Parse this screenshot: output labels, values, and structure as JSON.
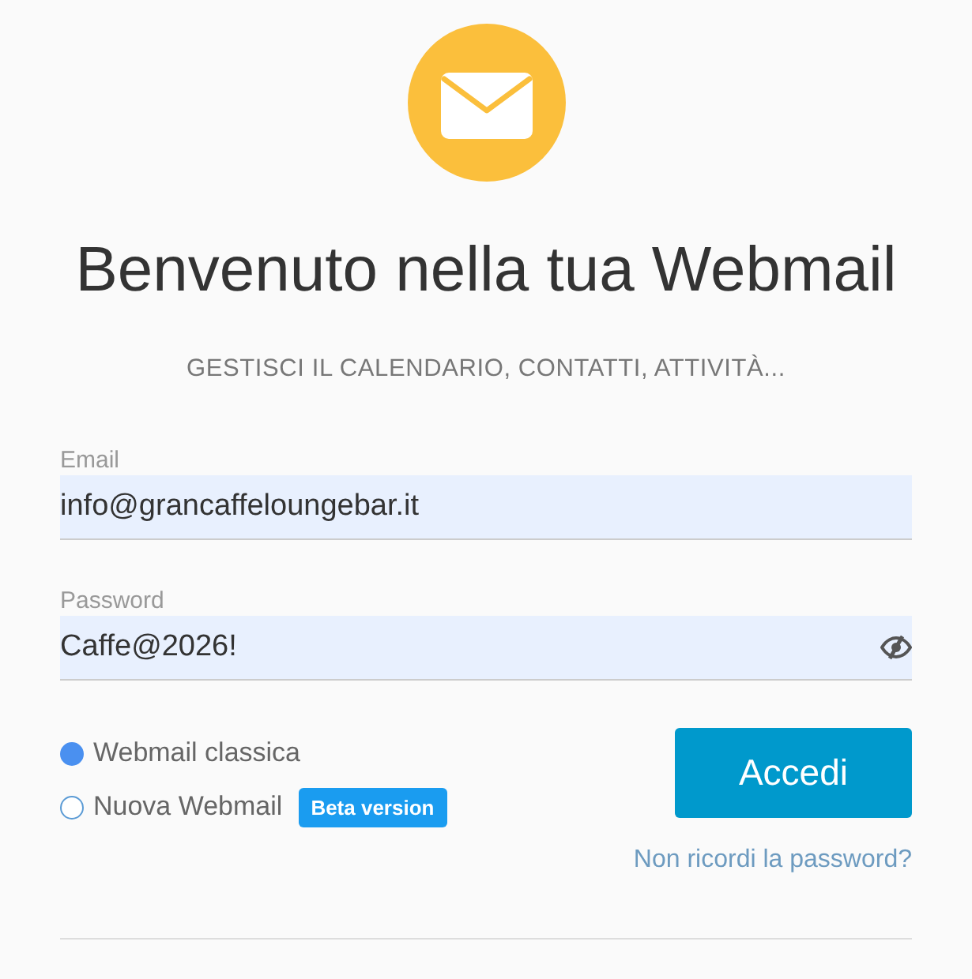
{
  "title": "Benvenuto nella tua Webmail",
  "subtitle": "GESTISCI IL CALENDARIO, CONTATTI, ATTIVITÀ...",
  "fields": [
    {
      "label": "Email",
      "value": "info@grancaffeloungebar.it",
      "kind": "text"
    },
    {
      "label": "Password",
      "value": "Caffe@2026!",
      "kind": "password"
    }
  ],
  "versions": [
    {
      "label": "Webmail classica",
      "selected": true
    },
    {
      "label": "Nuova Webmail",
      "selected": false,
      "badge": "Beta version"
    }
  ],
  "submit": "Accedi",
  "forgot_link": "Non ricordi la password?"
}
